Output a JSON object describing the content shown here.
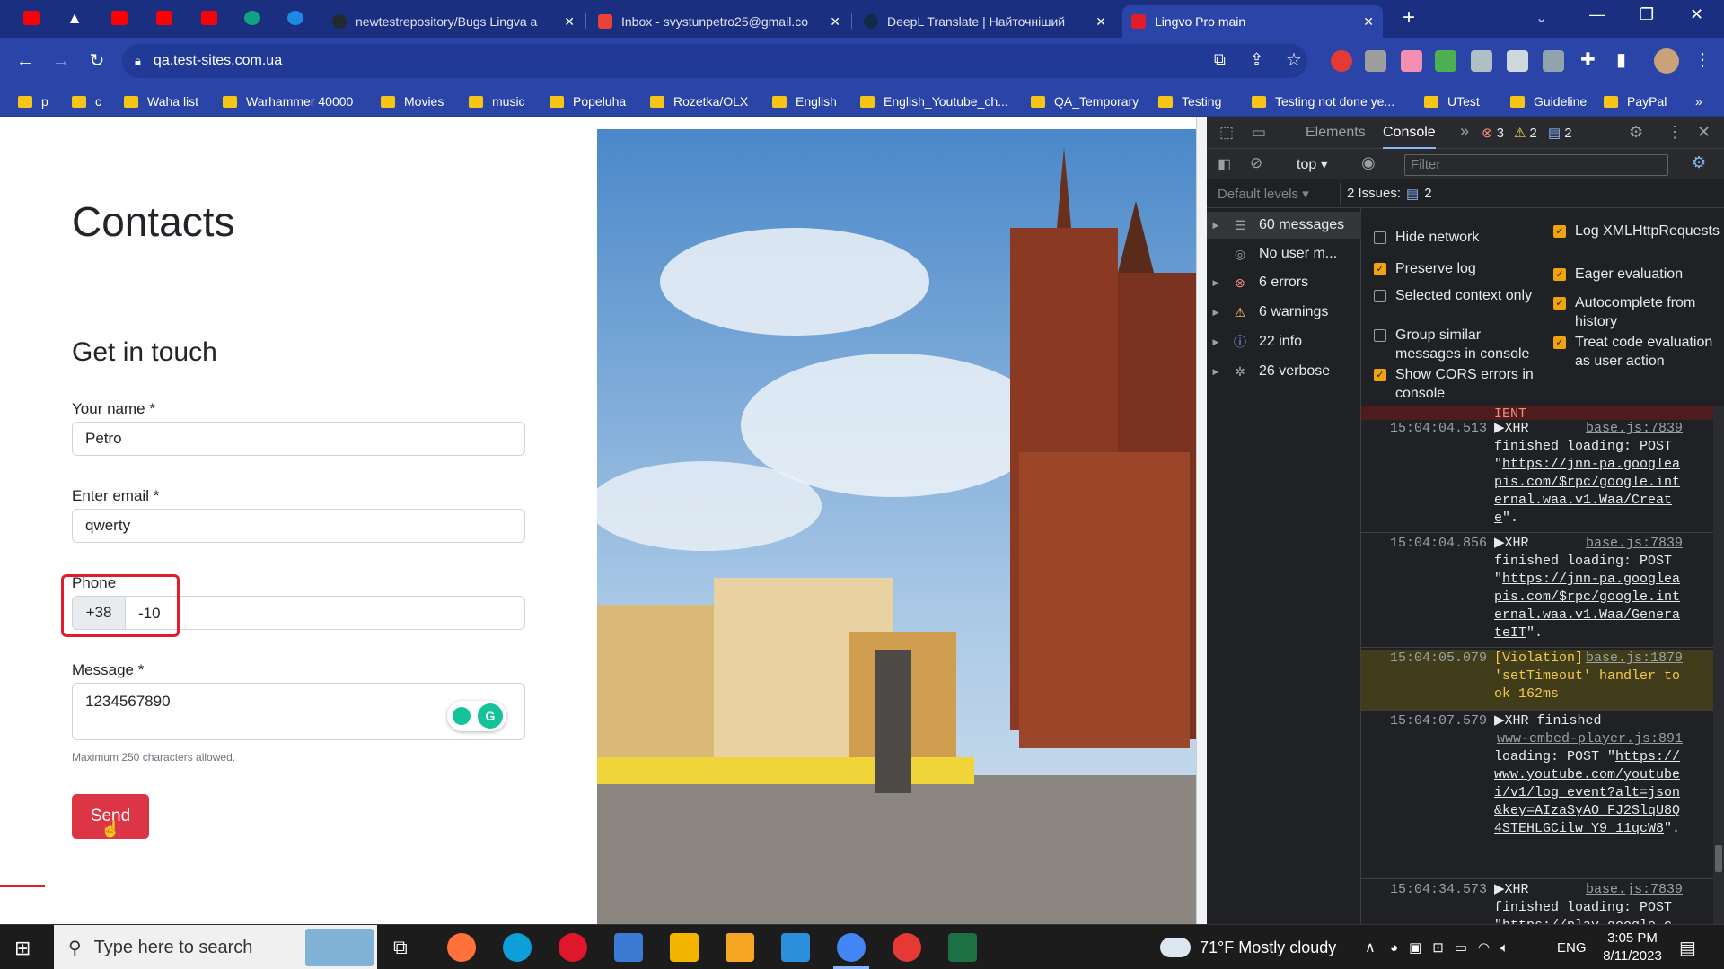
{
  "browser": {
    "tabs": [
      {
        "title": "newtestrepository/Bugs Lingva a",
        "icon": "github-icon",
        "color": "#24292e"
      },
      {
        "title": "Inbox - svystunpetro25@gmail.co",
        "icon": "gmail-icon",
        "color": "#ea4335"
      },
      {
        "title": "DeepL Translate | Найточніший",
        "icon": "deepl-icon",
        "color": "#0f2b46"
      },
      {
        "title": "Lingvo Pro main",
        "icon": "lingvo-icon",
        "color": "#e11d2c",
        "active": true
      }
    ],
    "url": "qa.test-sites.com.ua",
    "bookmarks": [
      "p",
      "c",
      "Waha list",
      "Warhammer 40000",
      "Movies",
      "music",
      "Popeluha",
      "Rozetka/OLX",
      "English",
      "English_Youtube_ch...",
      "QA_Temporary",
      "Testing",
      "Testing not done ye...",
      "UTest",
      "Guideline",
      "PayPal"
    ],
    "more_bookmarks": "»"
  },
  "page": {
    "heading": "Contacts",
    "subheading": "Get in touch",
    "name_label": "Your name *",
    "name_value": "Petro",
    "email_label": "Enter email *",
    "email_value": "qwerty",
    "phone_label": "Phone",
    "phone_prefix": "+38",
    "phone_value": "-10",
    "message_label": "Message *",
    "message_value": "1234567890",
    "message_hint": "Maximum 250 characters allowed.",
    "send_label": "Send"
  },
  "devtools": {
    "tabs": [
      "Elements",
      "Console"
    ],
    "active_tab": "Console",
    "more": "»",
    "errors_count": "3",
    "warnings_count": "2",
    "messages_count": "2",
    "context": "top",
    "filter_placeholder": "Filter",
    "default_levels": "Default levels",
    "issues_label": "2 Issues:",
    "issues_count": "2",
    "sidebar": [
      {
        "label": "60 messages",
        "icon": "list-icon"
      },
      {
        "label": "No user m...",
        "icon": "user-icon"
      },
      {
        "label": "6 errors",
        "icon": "error-icon"
      },
      {
        "label": "6 warnings",
        "icon": "warning-icon"
      },
      {
        "label": "22 info",
        "icon": "info-icon"
      },
      {
        "label": "26 verbose",
        "icon": "bug-icon"
      }
    ],
    "options_left": [
      {
        "label": "Hide network",
        "checked": false
      },
      {
        "label": "Preserve log",
        "checked": true
      },
      {
        "label": "Selected context only",
        "checked": false
      },
      {
        "label": "Group similar messages in console",
        "checked": false
      },
      {
        "label": "Show CORS errors in console",
        "checked": true
      }
    ],
    "options_right": [
      {
        "label": "Log XMLHttpRequests",
        "checked": true
      },
      {
        "label": "Eager evaluation",
        "checked": true
      },
      {
        "label": "Autocomplete from history",
        "checked": true
      },
      {
        "label": "Treat code evaluation as user action",
        "checked": true
      }
    ],
    "log_fragment": "IENT",
    "logs": [
      {
        "time": "15:04:04.513",
        "prefix": "▶XHR",
        "src": "base.js:7839",
        "text": "finished loading: POST \"",
        "link": "https://jnn-pa.googleapis.com/$rpc/google.internal.waa.v1.Waa/Create",
        "end": "\"."
      },
      {
        "time": "15:04:04.856",
        "prefix": "▶XHR",
        "src": "base.js:7839",
        "text": "finished loading: POST \"",
        "link": "https://jnn-pa.googleapis.com/$rpc/google.internal.waa.v1.Waa/GenerateIT",
        "end": "\"."
      },
      {
        "time": "15:04:05.079",
        "prefix": "[Violation] 'setTimeout' handler took 162ms",
        "src": "base.js:1879",
        "warn": true
      },
      {
        "time": "15:04:07.579",
        "prefix": "▶XHR finished",
        "src": "www-embed-player.js:891",
        "text": "loading: POST \"",
        "link": "https://www.youtube.com/youtubei/v1/log_event?alt=json&key=AIzaSyAO_FJ2SlqU8Q4STEHLGCilw_Y9_11qcW8",
        "end": "\"."
      },
      {
        "time": "15:04:34.573",
        "prefix": "▶XHR",
        "src": "base.js:7839",
        "text": "finished loading: POST \"https://play.google.c"
      }
    ]
  },
  "taskbar": {
    "search_placeholder": "Type here to search",
    "weather": "71°F  Mostly cloudy",
    "lang": "ENG",
    "time": "3:05 PM",
    "date": "8/11/2023"
  }
}
